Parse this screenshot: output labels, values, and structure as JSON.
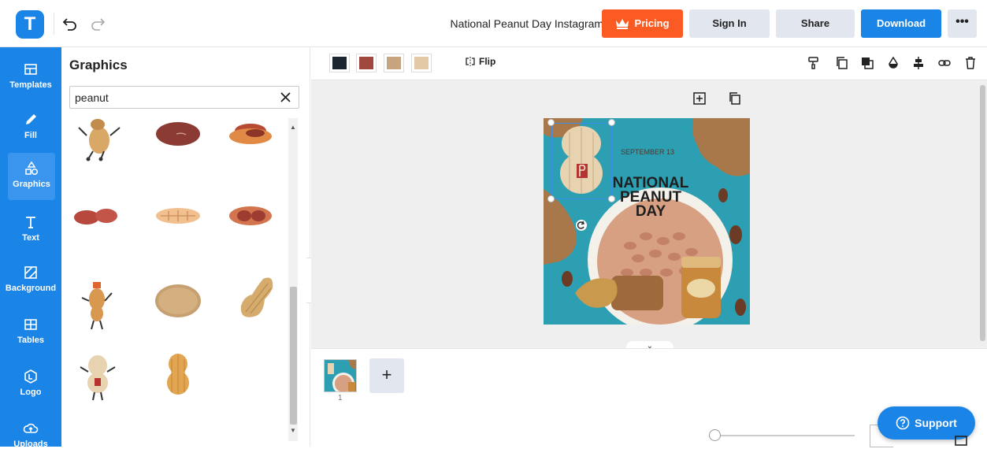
{
  "app": {
    "logo_letter": "T"
  },
  "header": {
    "doc_title": "National Peanut Day Instagram Post",
    "pricing_label": "Pricing",
    "signin_label": "Sign In",
    "share_label": "Share",
    "download_label": "Download",
    "more_label": "•••"
  },
  "nav": [
    {
      "label": "Templates",
      "icon": "templates-icon"
    },
    {
      "label": "Fill",
      "icon": "pencil-icon"
    },
    {
      "label": "Graphics",
      "icon": "shapes-icon"
    },
    {
      "label": "Text",
      "icon": "text-icon"
    },
    {
      "label": "Background",
      "icon": "background-icon"
    },
    {
      "label": "Tables",
      "icon": "table-icon"
    },
    {
      "label": "Logo",
      "icon": "logo-icon"
    },
    {
      "label": "Uploads",
      "icon": "upload-cloud-icon"
    }
  ],
  "panel": {
    "title": "Graphics",
    "search_value": "peanut"
  },
  "toolbar": {
    "swatches": [
      "#1b2631",
      "#a0473d",
      "#c5a47e",
      "#e3c9a5"
    ],
    "flip_label": "Flip"
  },
  "artboard": {
    "date_text": "SEPTEMBER 13",
    "title_line1": "NATIONAL",
    "title_line2": "PEANUT",
    "title_line3": "DAY"
  },
  "pages": {
    "page_number": "1",
    "add_label": "+"
  },
  "support": {
    "label": "Support"
  },
  "colors": {
    "primary": "#1b84e7",
    "pricing": "#fb5a22",
    "button_gray": "#e2e6ee",
    "canvas_bg": "#efefef",
    "artboard_bg": "#2d9fb2"
  }
}
